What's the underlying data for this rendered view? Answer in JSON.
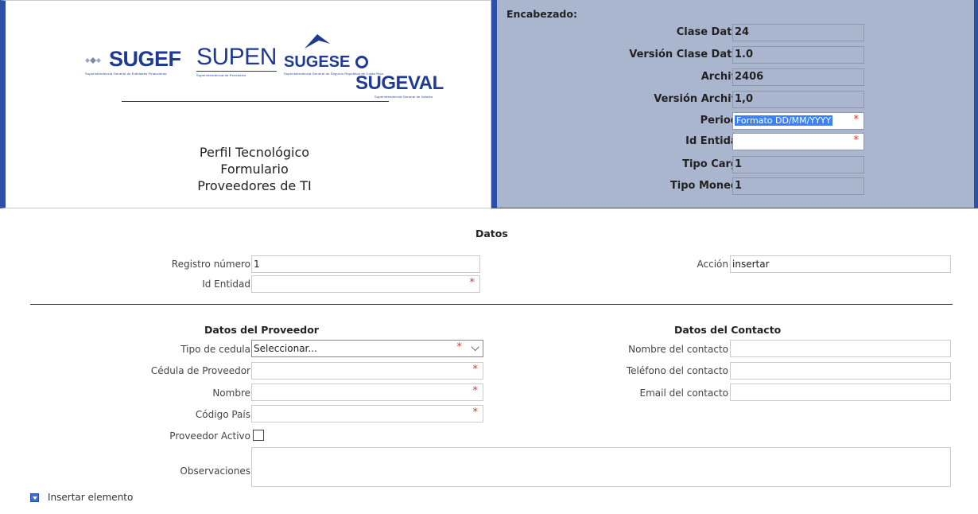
{
  "header": {
    "logos": {
      "sugef": {
        "name": "SUGEF",
        "sub": "Superintendencia General de Entidades Financieras"
      },
      "supen": {
        "name": "SUPEN",
        "sub": "Superintendencia de Pensiones"
      },
      "sugese": {
        "name": "SUGESE",
        "sub": "Superintendencia General de Seguros República de Costa Rica"
      },
      "sugeval": {
        "name": "SUGEVAL",
        "sub": "Superintendencia General de Valores"
      }
    },
    "title_lines": [
      "Perfil Tecnológico",
      "Formulario",
      "Proveedores de TI"
    ],
    "encabezado_label": "Encabezado:",
    "fields": {
      "clase_datos": {
        "label": "Clase Datos",
        "value": "24"
      },
      "version_clase_datos": {
        "label": "Versión Clase Datos",
        "value": "1.0"
      },
      "archivo": {
        "label": "Archivo",
        "value": "2406"
      },
      "version_archivo": {
        "label": "Versión Archivo",
        "value": "1,0"
      },
      "periodo": {
        "label": "Periodo",
        "placeholder": "Formato DD/MM/YYYY",
        "required": "*"
      },
      "id_entidad": {
        "label": "Id Entidad",
        "value": "",
        "required": "*"
      },
      "tipo_carga": {
        "label": "Tipo Carga",
        "value": "1"
      },
      "tipo_moneda": {
        "label": "Tipo Moneda",
        "value": "1"
      }
    }
  },
  "datos": {
    "title": "Datos",
    "registro_numero": {
      "label": "Registro número",
      "value": "1"
    },
    "id_entidad": {
      "label": "Id Entidad",
      "value": "",
      "required": "*"
    },
    "accion": {
      "label": "Acción",
      "value": "insertar"
    }
  },
  "proveedor": {
    "title": "Datos del Proveedor",
    "tipo_cedula": {
      "label": "Tipo de cedula",
      "value": "Seleccionar...",
      "required": "*"
    },
    "cedula": {
      "label": "Cédula de Proveedor",
      "value": "",
      "required": "*"
    },
    "nombre": {
      "label": "Nombre",
      "value": "",
      "required": "*"
    },
    "codigo_pais": {
      "label": "Código País",
      "value": "",
      "required": "*"
    },
    "activo": {
      "label": "Proveedor Activo",
      "checked": false
    },
    "observaciones": {
      "label": "Observaciones",
      "value": ""
    }
  },
  "contacto": {
    "title": "Datos del Contacto",
    "nombre": {
      "label": "Nombre del contacto",
      "value": ""
    },
    "telefono": {
      "label": "Teléfono del contacto",
      "value": ""
    },
    "email": {
      "label": "Email del contacto",
      "value": ""
    }
  },
  "footer": {
    "insertar_label": "Insertar elemento"
  },
  "colors": {
    "header_bg": "#a9b6cd",
    "accent_border": "#2c4fa8",
    "required": "#e0322b",
    "selection": "#3b82f6"
  }
}
